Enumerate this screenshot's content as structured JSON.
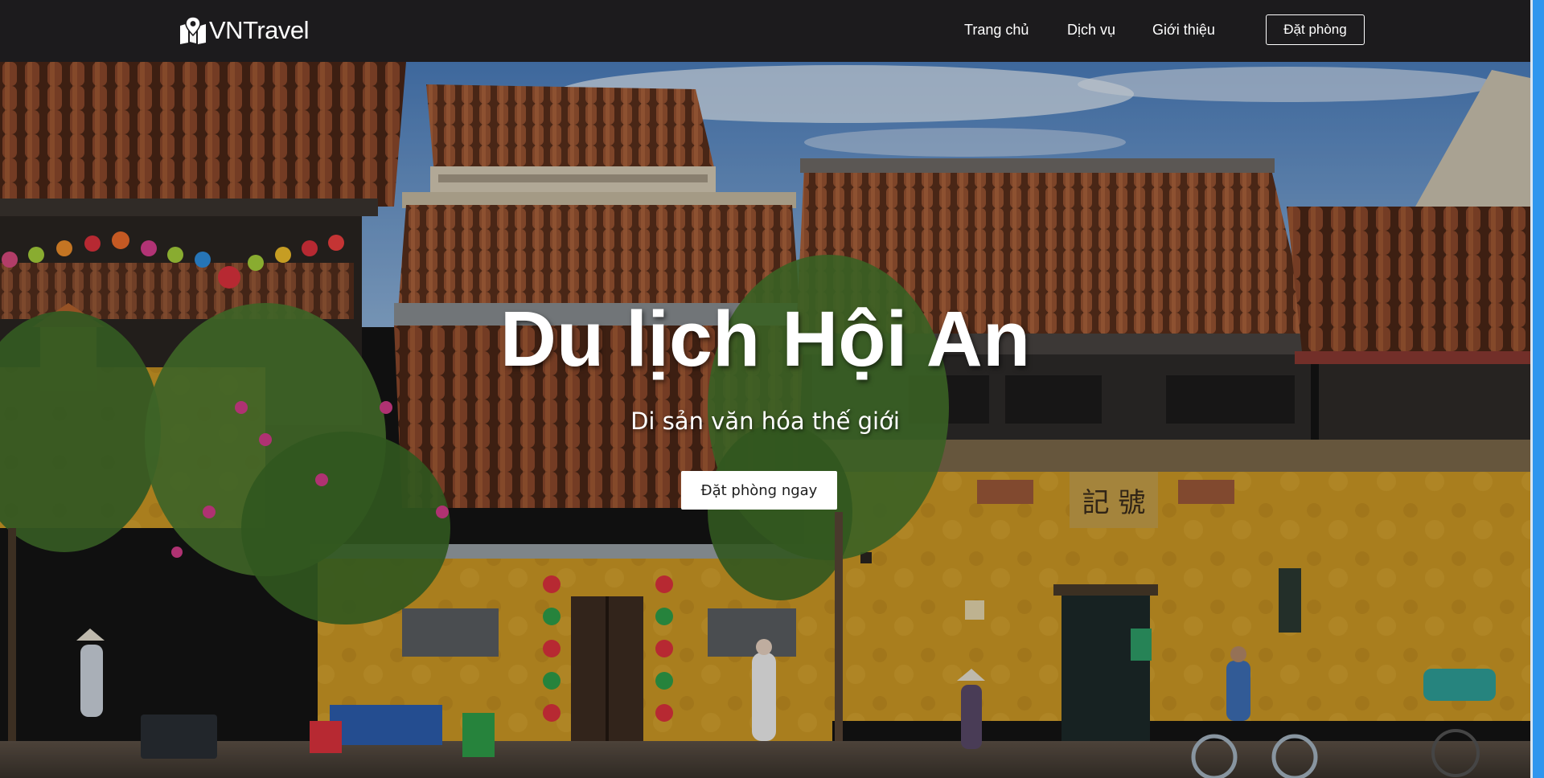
{
  "navbar": {
    "brand_name": "VNTravel",
    "brand_icon": "map-pin-icon",
    "links": [
      {
        "label": "Trang chủ"
      },
      {
        "label": "Dịch vụ"
      },
      {
        "label": "Giới thiệu"
      }
    ],
    "book_label": "Đặt phòng"
  },
  "hero": {
    "title": "Du lịch Hội An",
    "subtitle": "Di sản văn hóa thế giới",
    "cta_label": "Đặt phòng ngay"
  },
  "colors": {
    "navbar_bg": "#1c1b1d",
    "wall_yellow": "#d6a22a",
    "roof_tile": "#8b4a2b",
    "sky": "#5d8fc6",
    "cta_bg": "#ffffff"
  }
}
